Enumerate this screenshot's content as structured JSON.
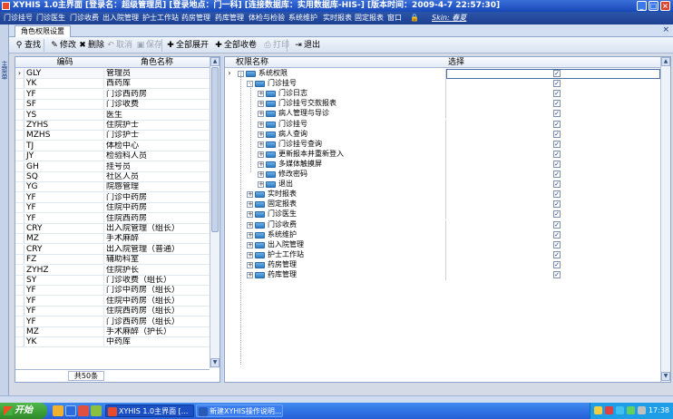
{
  "window": {
    "title": "XYHIS 1.0主界面  [登录名：超级管理员] [登录地点：门一科] [连接数据库：实用数据库-HIS-] [版本时间：2009-4-7 22:57:30]"
  },
  "menu": [
    "门诊挂号",
    "门诊医生",
    "门诊收费",
    "出入院管理",
    "护士工作站",
    "药房管理",
    "药库管理",
    "体检与检验",
    "系统维护",
    "实时报表",
    "固定报表",
    "窗口",
    "Skin: 春夏"
  ],
  "side_label": "主菜单",
  "tab": {
    "label": "角色权限设置",
    "close": "×"
  },
  "toolbar": [
    {
      "label": "查找",
      "icon": "search-icon",
      "sym": "⚲",
      "enabled": true
    },
    {
      "label": "修改",
      "icon": "pencil-icon",
      "sym": "✎",
      "enabled": true
    },
    {
      "label": "删除",
      "icon": "delete-icon",
      "sym": "✖",
      "enabled": true
    },
    {
      "label": "取消",
      "icon": "undo-icon",
      "sym": "↶",
      "enabled": false
    },
    {
      "label": "保存",
      "icon": "save-icon",
      "sym": "▣",
      "enabled": false
    },
    {
      "label": "全部展开",
      "icon": "expand-icon",
      "sym": "✚",
      "enabled": true
    },
    {
      "label": "全部收卷",
      "icon": "collapse-icon",
      "sym": "✚",
      "enabled": true
    },
    {
      "label": "打印",
      "icon": "print-icon",
      "sym": "⎙",
      "enabled": false
    },
    {
      "label": "退出",
      "icon": "exit-icon",
      "sym": "⇥",
      "enabled": true
    }
  ],
  "roles": {
    "headers": [
      "编码",
      "角色名称"
    ],
    "rows": [
      [
        "GLY",
        "管理员"
      ],
      [
        "YK",
        "西药库"
      ],
      [
        "YF",
        "门诊西药房"
      ],
      [
        "SF",
        "门诊收费"
      ],
      [
        "YS",
        "医生"
      ],
      [
        "ZYHS",
        "住院护士"
      ],
      [
        "MZHS",
        "门诊护士"
      ],
      [
        "TJ",
        "体检中心"
      ],
      [
        "JY",
        "检验科人员"
      ],
      [
        "GH",
        "挂号员"
      ],
      [
        "SQ",
        "社区人员"
      ],
      [
        "YG",
        "院感管理"
      ],
      [
        "YF",
        "门诊中药房"
      ],
      [
        "YF",
        "住院中药房"
      ],
      [
        "YF",
        "住院西药房"
      ],
      [
        "CRY",
        "出入院管理（组长）"
      ],
      [
        "MZ",
        "手术麻醉"
      ],
      [
        "CRY",
        "出入院管理（普通）"
      ],
      [
        "FZ",
        "辅助科室"
      ],
      [
        "ZYHZ",
        "住院护长"
      ],
      [
        "SY",
        "门诊收费（组长）"
      ],
      [
        "YF",
        "门诊中药房（组长）"
      ],
      [
        "YF",
        "住院中药房（组长）"
      ],
      [
        "YF",
        "住院西药房（组长）"
      ],
      [
        "YF",
        "门诊西药房（组长）"
      ],
      [
        "MZ",
        "手术麻醉（护长）"
      ],
      [
        "YK",
        "中药库"
      ]
    ],
    "footer": "共50条"
  },
  "perm": {
    "headers": [
      "权限名称",
      "选择"
    ],
    "tree": [
      {
        "label": "系统权限",
        "level": 0,
        "exp": "-"
      },
      {
        "label": "门诊挂号",
        "level": 1,
        "exp": "-"
      },
      {
        "label": "门诊日志",
        "level": 2,
        "exp": "+"
      },
      {
        "label": "门诊挂号交款报表",
        "level": 2,
        "exp": "+"
      },
      {
        "label": "病人管理与导诊",
        "level": 2,
        "exp": "+"
      },
      {
        "label": "门诊挂号",
        "level": 2,
        "exp": "+"
      },
      {
        "label": "病人查询",
        "level": 2,
        "exp": "+"
      },
      {
        "label": "门诊挂号查询",
        "level": 2,
        "exp": "+"
      },
      {
        "label": "更新报本并重新登入",
        "level": 2,
        "exp": "+"
      },
      {
        "label": "多媒体触摸屏",
        "level": 2,
        "exp": "+"
      },
      {
        "label": "修改密码",
        "level": 2,
        "exp": "+"
      },
      {
        "label": "退出",
        "level": 2,
        "exp": "+"
      },
      {
        "label": "实时报表",
        "level": 1,
        "exp": "+"
      },
      {
        "label": "固定报表",
        "level": 1,
        "exp": "+"
      },
      {
        "label": "门诊医生",
        "level": 1,
        "exp": "+"
      },
      {
        "label": "门诊收费",
        "level": 1,
        "exp": "+"
      },
      {
        "label": "系统维护",
        "level": 1,
        "exp": "+"
      },
      {
        "label": "出入院管理",
        "level": 1,
        "exp": "+"
      },
      {
        "label": "护士工作站",
        "level": 1,
        "exp": "+"
      },
      {
        "label": "药房管理",
        "level": 1,
        "exp": "+"
      },
      {
        "label": "药库管理",
        "level": 1,
        "exp": "+"
      }
    ]
  },
  "taskbar": {
    "start": "开始",
    "tasks": [
      "XYHIS 1.0主界面  [...",
      "新建XYHIS操作说明..."
    ],
    "clock": "17:38"
  }
}
